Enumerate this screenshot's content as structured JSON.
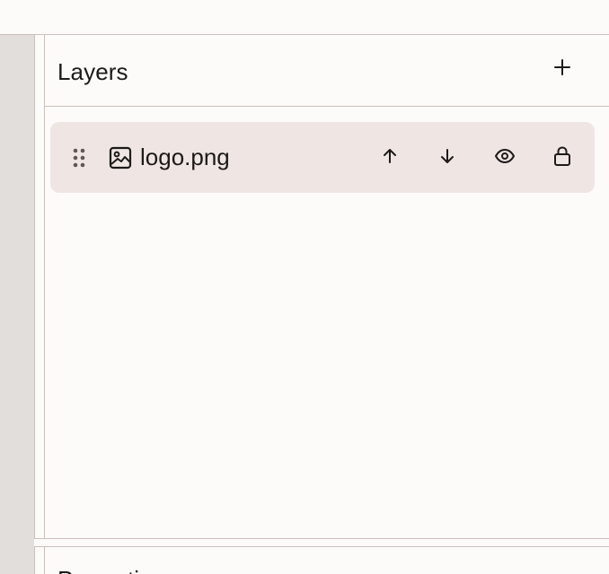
{
  "layers_panel": {
    "title": "Layers",
    "add_icon": "plus-icon",
    "items": [
      {
        "name": "logo.png",
        "type_icon": "image-icon",
        "selected": true,
        "actions": [
          "move-up-icon",
          "move-down-icon",
          "eye-icon",
          "lock-icon"
        ]
      }
    ]
  },
  "next_panel": {
    "title": "Properties"
  },
  "colors": {
    "background": "#fdfbf9",
    "selected_row": "#efe6e4",
    "rail": "#e2dedb",
    "border": "#cbbfbb",
    "text": "#1d1a18"
  }
}
